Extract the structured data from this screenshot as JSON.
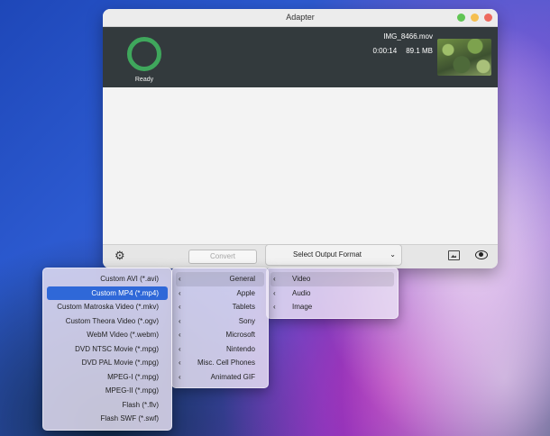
{
  "window": {
    "title": "Adapter",
    "controls": {
      "close": "#ed6a5e",
      "minimize": "#f5bf4f",
      "maximize": "#61c554"
    }
  },
  "file": {
    "status": "Ready",
    "name": "IMG_8466.mov",
    "duration": "0:00:14",
    "size": "89.1 MB"
  },
  "toolbar": {
    "settings_icon": "gear-icon",
    "convert_label": "Convert",
    "format_label": "Select Output Format",
    "format_chevron": "⌄",
    "preview_icon": "image-icon",
    "eye_icon": "eye-icon"
  },
  "menus": {
    "categories": [
      {
        "label": "Video"
      },
      {
        "label": "Audio"
      },
      {
        "label": "Image"
      }
    ],
    "video_groups": [
      {
        "label": "General"
      },
      {
        "label": "Apple"
      },
      {
        "label": "Tablets"
      },
      {
        "label": "Sony"
      },
      {
        "label": "Microsoft"
      },
      {
        "label": "Nintendo"
      },
      {
        "label": "Misc. Cell Phones"
      },
      {
        "label": "Animated GIF"
      }
    ],
    "general_formats": [
      {
        "label": "Custom AVI (*.avi)"
      },
      {
        "label": "Custom MP4 (*.mp4)"
      },
      {
        "label": "Custom Matroska Video (*.mkv)"
      },
      {
        "label": "Custom Theora Video (*.ogv)"
      },
      {
        "label": "WebM Video (*.webm)"
      },
      {
        "label": "DVD NTSC Movie (*.mpg)"
      },
      {
        "label": "DVD PAL Movie (*.mpg)"
      },
      {
        "label": "MPEG-I (*.mpg)"
      },
      {
        "label": "MPEG-II (*.mpg)"
      },
      {
        "label": "Flash (*.flv)"
      },
      {
        "label": "Flash SWF (*.swf)"
      }
    ]
  },
  "colors": {
    "accent": "#2f68d8",
    "progress_ring": "#3fa75c",
    "header_bg": "#333a3d"
  }
}
